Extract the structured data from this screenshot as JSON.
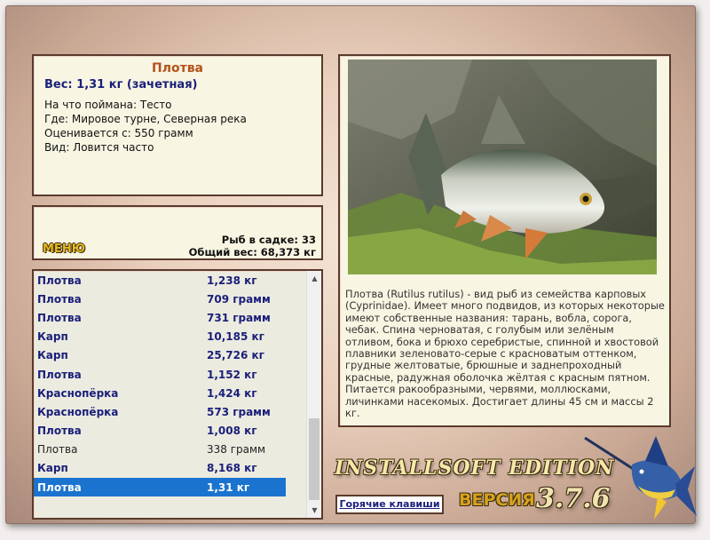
{
  "fish": {
    "title": "Плотва",
    "weight": "Вес: 1,31 кг (зачетная)",
    "bait": "На что поймана: Тесто",
    "location": "Где: Мировое турне, Северная река",
    "valued_from": "Оценивается с: 550 грамм",
    "kind": "Вид: Ловится часто"
  },
  "stats": {
    "menu_label": "МЕНЮ",
    "fish_count": "Рыб в садке: 33",
    "total_weight": "Общий вес: 68,373 кг"
  },
  "catch_list": [
    {
      "name": "Плотва",
      "weight": "1,238 кг",
      "style": "bold"
    },
    {
      "name": "Плотва",
      "weight": "709 грамм",
      "style": "bold"
    },
    {
      "name": "Плотва",
      "weight": "731 грамм",
      "style": "bold"
    },
    {
      "name": "Карп",
      "weight": "10,185 кг",
      "style": "bold"
    },
    {
      "name": "Карп",
      "weight": "25,726 кг",
      "style": "bold"
    },
    {
      "name": "Плотва",
      "weight": "1,152 кг",
      "style": "bold"
    },
    {
      "name": "Краснопёрка",
      "weight": "1,424 кг",
      "style": "bold"
    },
    {
      "name": "Краснопёрка",
      "weight": "573 грамм",
      "style": "bold"
    },
    {
      "name": "Плотва",
      "weight": "1,008 кг",
      "style": "bold"
    },
    {
      "name": "Плотва",
      "weight": "338 грамм",
      "style": "normal"
    },
    {
      "name": "Карп",
      "weight": "8,168 кг",
      "style": "bold"
    },
    {
      "name": "Плотва",
      "weight": "1,31 кг",
      "style": "selected"
    }
  ],
  "description": "Плотва (Rutilus rutilus) - вид рыб из семейства карповых (Cyprinidae). Имеет много подвидов, из которых некоторые имеют собственные названия: тарань, вобла, сорога, чебак. Спина черноватая, с голубым или зелёным отливом, бока и брюхо серебристые, спинной и хвостовой плавники зеленовато-серые с красноватым оттенком, грудные желтоватые, брюшные и заднепроходный красные, радужная оболочка жёлтая с красным пятном. Питается ракообразными, червями, моллюсками, личинками насекомых. Достигает длины 45 см и массы 2 кг.",
  "brand": {
    "edition": "INSTALLSOFT EDITION",
    "hotkeys_button": "Горячие клавиши",
    "version_label": "ВЕРСИЯ",
    "version_number": "3.7.6"
  },
  "icons": {
    "scroll_up": "triangle-up",
    "scroll_down": "triangle-down",
    "logo": "marlin-icon"
  },
  "colors": {
    "accent_title": "#b4521c",
    "list_text": "#1a1f7a",
    "selection": "#1a74cf"
  }
}
